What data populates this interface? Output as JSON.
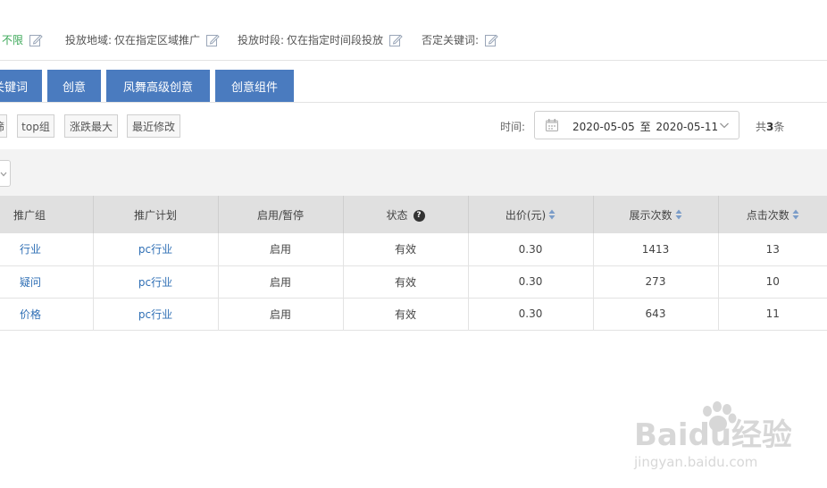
{
  "settings": [
    {
      "label": "",
      "value": "不限"
    },
    {
      "label": "投放地域:",
      "value": "仅在指定区域推广"
    },
    {
      "label": "投放时段:",
      "value": "仅在指定时间段投放"
    },
    {
      "label": "否定关键词:",
      "value": ""
    }
  ],
  "tabs": [
    {
      "label": "关键词"
    },
    {
      "label": "创意"
    },
    {
      "label": "凤舞高级创意"
    },
    {
      "label": "创意组件"
    }
  ],
  "filters": {
    "chips": [
      "筛",
      "top组",
      "涨跌最大",
      "最近修改"
    ],
    "time_label": "时间:",
    "date_start": "2020-05-05",
    "date_sep": "至",
    "date_end": "2020-05-11",
    "total_prefix": "共",
    "total_count": "3",
    "total_suffix": "条"
  },
  "table": {
    "headers": [
      "推广组",
      "推广计划",
      "启用/暂停",
      "状态",
      "出价(元)",
      "展示次数",
      "点击次数"
    ],
    "rows": [
      [
        "行业",
        "pc行业",
        "启用",
        "有效",
        "0.30",
        "1413",
        "13"
      ],
      [
        "疑问",
        "pc行业",
        "启用",
        "有效",
        "0.30",
        "273",
        "10"
      ],
      [
        "价格",
        "pc行业",
        "启用",
        "有效",
        "0.30",
        "643",
        "11"
      ]
    ]
  },
  "watermark": {
    "brand": "Baidu经验",
    "url": "jingyan.baidu.com"
  },
  "colors": {
    "accent": "#4a7bbf",
    "link": "#2f6fb5",
    "green": "#3aa757",
    "header_bg": "#e0e0e0"
  },
  "icons": {
    "edit": "edit-icon",
    "calendar": "calendar-icon",
    "sort": "sort-icon",
    "help": "help-icon",
    "chevron": "chevron-down-icon"
  }
}
